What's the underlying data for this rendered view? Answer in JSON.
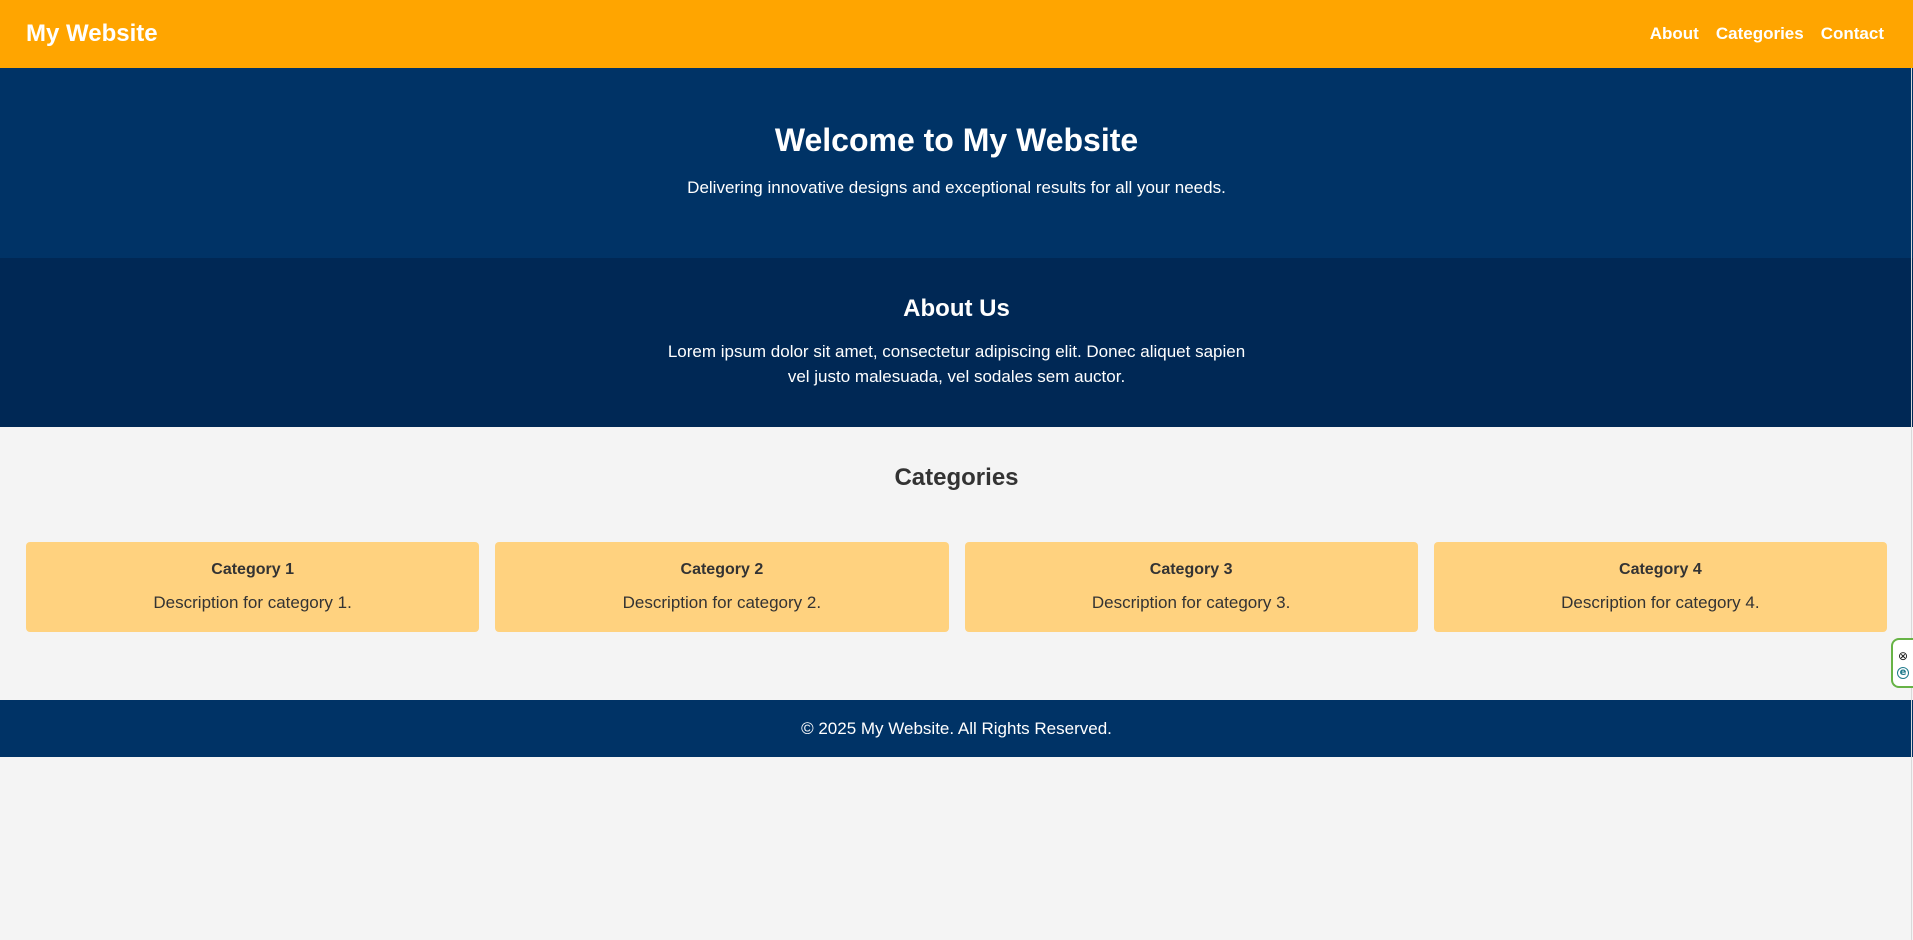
{
  "header": {
    "logo": "My Website",
    "nav": [
      {
        "label": "About"
      },
      {
        "label": "Categories"
      },
      {
        "label": "Contact"
      }
    ]
  },
  "hero": {
    "title": "Welcome to My Website",
    "subtitle": "Delivering innovative designs and exceptional results for all your needs."
  },
  "about": {
    "title": "About Us",
    "text": "Lorem ipsum dolor sit amet, consectetur adipiscing elit. Donec aliquet sapien vel justo malesuada, vel sodales sem auctor."
  },
  "categories": {
    "title": "Categories",
    "items": [
      {
        "title": "Category 1",
        "description": "Description for category 1."
      },
      {
        "title": "Category 2",
        "description": "Description for category 2."
      },
      {
        "title": "Category 3",
        "description": "Description for category 3."
      },
      {
        "title": "Category 4",
        "description": "Description for category 4."
      }
    ]
  },
  "footer": {
    "text": "© 2025 My Website. All Rights Reserved."
  },
  "widget": {
    "close_symbol": "⊗",
    "e_symbol": "e"
  },
  "colors": {
    "header": "#ffa500",
    "hero": "#003366",
    "about": "#002855",
    "card": "#ffd27f",
    "page_background": "#f4f4f4",
    "footer": "#003366",
    "widget_border": "#67b346"
  },
  "icons": {
    "widget_close": "close-circle-icon",
    "widget_e": "e-circle-icon"
  }
}
